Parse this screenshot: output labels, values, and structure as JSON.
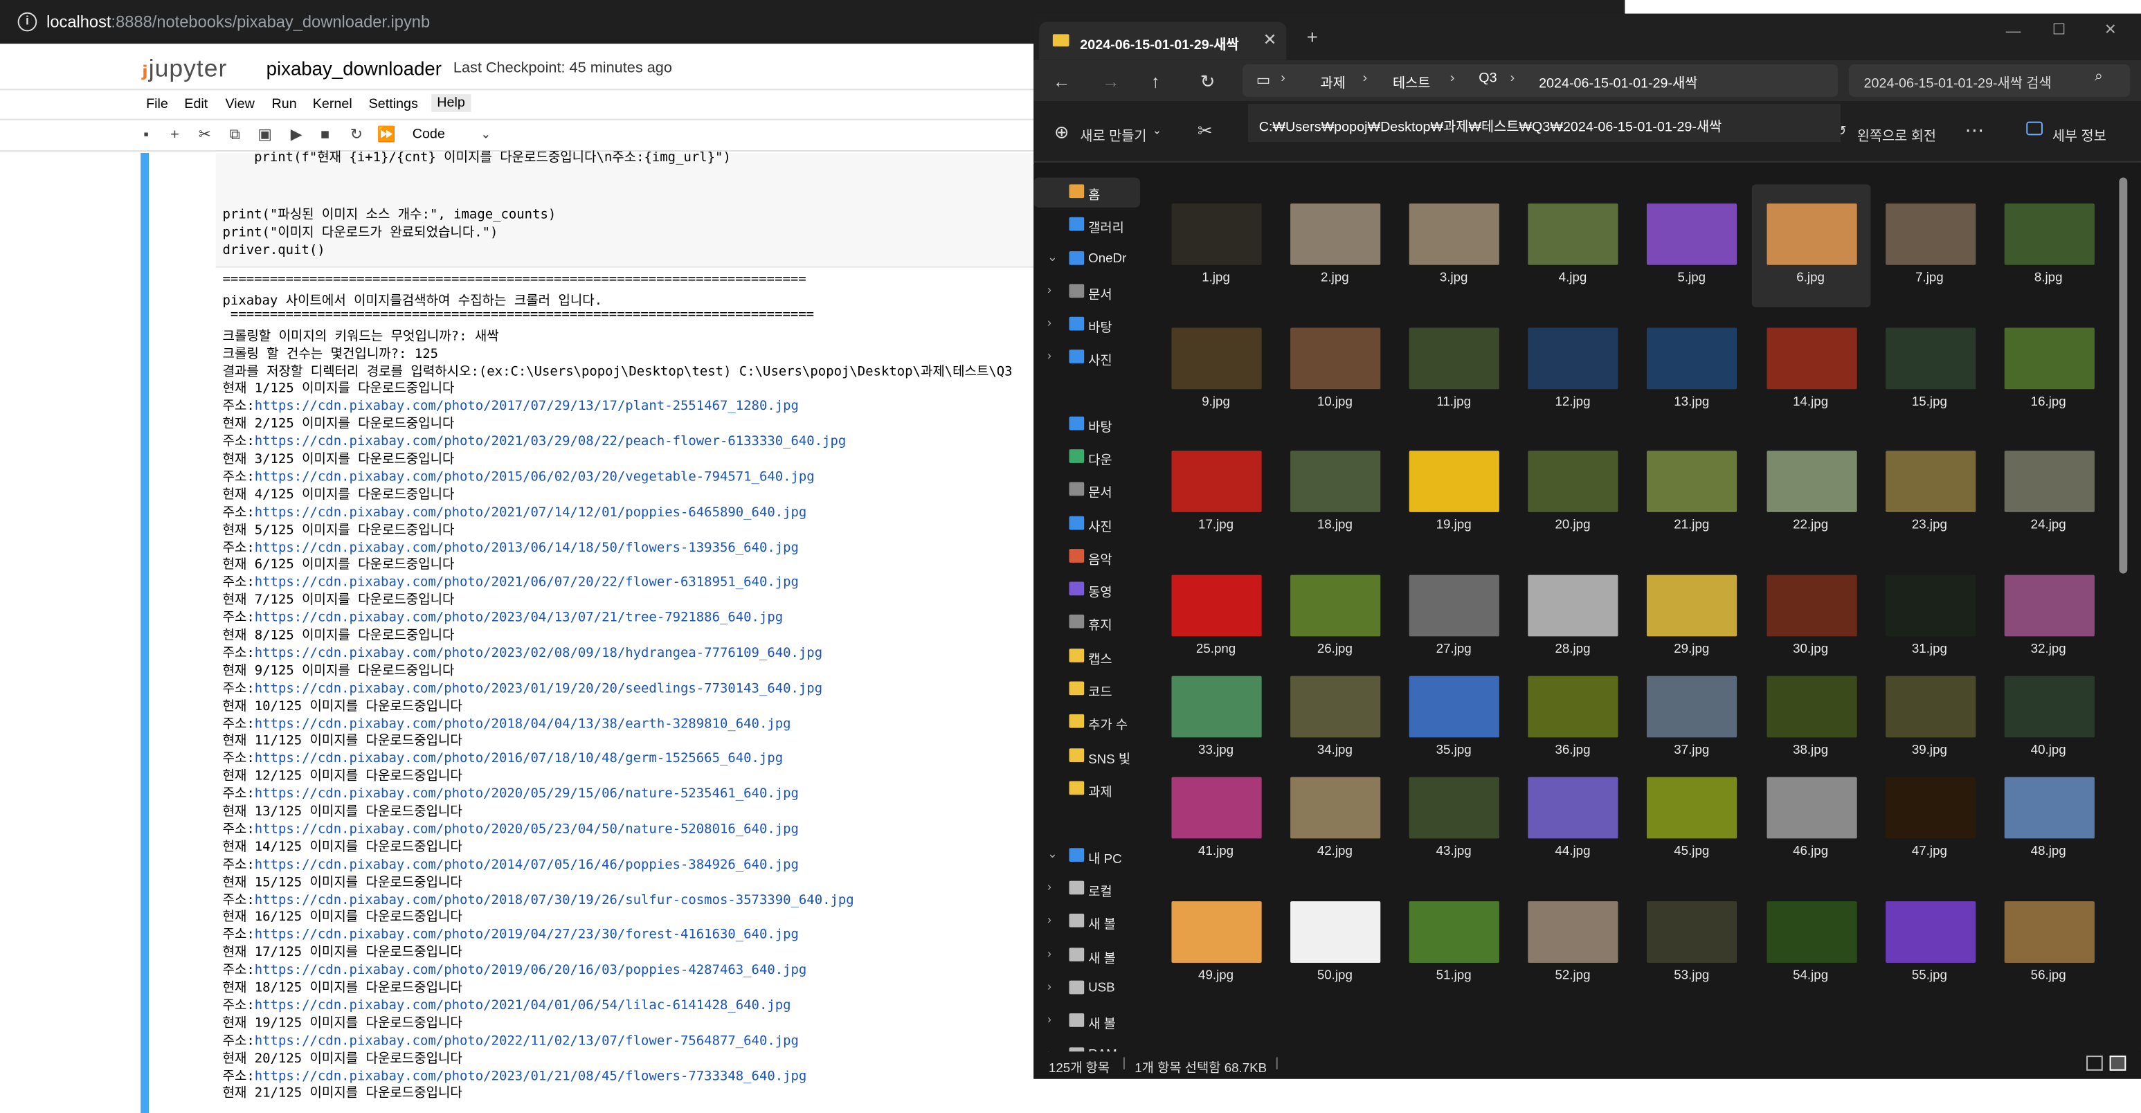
{
  "browser": {
    "host": "localhost",
    "url_path": ":8888/notebooks/pixabay_downloader.ipynb"
  },
  "notebook": {
    "logo": "jupyter",
    "name": "pixabay_downloader",
    "checkpoint": "Last Checkpoint: 45 minutes ago",
    "menu": [
      "File",
      "Edit",
      "View",
      "Run",
      "Kernel",
      "Settings",
      "Help"
    ],
    "celltype": "Code",
    "code_lines": [
      "    print(f\"현재 {i+1}/{cnt} 이미지를 다운로드중입니다\\n주소:{img_url}\")",
      "",
      "",
      "print(\"파싱된 이미지 소스 개수:\", image_counts)",
      "print(\"이미지 다운로드가 완료되었습니다.\")",
      "driver.quit()"
    ],
    "output_lines": [
      "==========================================================================",
      "pixabay 사이트에서 이미지를검색하여 수집하는 크롤러 입니다.",
      " ==========================================================================",
      "크롤링할 이미지의 키워드는 무엇입니까?: 새싹",
      "크롤링 할 건수는 몇건입니까?: 125",
      "결과를 저장할 디렉터리 경로를 입력하시오:(ex:C:\\Users\\popoj\\Desktop\\test) C:\\Users\\popoj\\Desktop\\과제\\테스트\\Q3",
      "현재 1/125 이미지를 다운로드중입니다",
      "주소:https://cdn.pixabay.com/photo/2017/07/29/13/17/plant-2551467_1280.jpg",
      "현재 2/125 이미지를 다운로드중입니다",
      "주소:https://cdn.pixabay.com/photo/2021/03/29/08/22/peach-flower-6133330_640.jpg",
      "현재 3/125 이미지를 다운로드중입니다",
      "주소:https://cdn.pixabay.com/photo/2015/06/02/03/20/vegetable-794571_640.jpg",
      "현재 4/125 이미지를 다운로드중입니다",
      "주소:https://cdn.pixabay.com/photo/2021/07/14/12/01/poppies-6465890_640.jpg",
      "현재 5/125 이미지를 다운로드중입니다",
      "주소:https://cdn.pixabay.com/photo/2013/06/14/18/50/flowers-139356_640.jpg",
      "현재 6/125 이미지를 다운로드중입니다",
      "주소:https://cdn.pixabay.com/photo/2021/06/07/20/22/flower-6318951_640.jpg",
      "현재 7/125 이미지를 다운로드중입니다",
      "주소:https://cdn.pixabay.com/photo/2023/04/13/07/21/tree-7921886_640.jpg",
      "현재 8/125 이미지를 다운로드중입니다",
      "주소:https://cdn.pixabay.com/photo/2023/02/08/09/18/hydrangea-7776109_640.jpg",
      "현재 9/125 이미지를 다운로드중입니다",
      "주소:https://cdn.pixabay.com/photo/2023/01/19/20/20/seedlings-7730143_640.jpg",
      "현재 10/125 이미지를 다운로드중입니다",
      "주소:https://cdn.pixabay.com/photo/2018/04/04/13/38/earth-3289810_640.jpg",
      "현재 11/125 이미지를 다운로드중입니다",
      "주소:https://cdn.pixabay.com/photo/2016/07/18/10/48/germ-1525665_640.jpg",
      "현재 12/125 이미지를 다운로드중입니다",
      "주소:https://cdn.pixabay.com/photo/2020/05/29/15/06/nature-5235461_640.jpg",
      "현재 13/125 이미지를 다운로드중입니다",
      "주소:https://cdn.pixabay.com/photo/2020/05/23/04/50/nature-5208016_640.jpg",
      "현재 14/125 이미지를 다운로드중입니다",
      "주소:https://cdn.pixabay.com/photo/2014/07/05/16/46/poppies-384926_640.jpg",
      "현재 15/125 이미지를 다운로드중입니다",
      "주소:https://cdn.pixabay.com/photo/2018/07/30/19/26/sulfur-cosmos-3573390_640.jpg",
      "현재 16/125 이미지를 다운로드중입니다",
      "주소:https://cdn.pixabay.com/photo/2019/04/27/23/30/forest-4161630_640.jpg",
      "현재 17/125 이미지를 다운로드중입니다",
      "주소:https://cdn.pixabay.com/photo/2019/06/20/16/03/poppies-4287463_640.jpg",
      "현재 18/125 이미지를 다운로드중입니다",
      "주소:https://cdn.pixabay.com/photo/2021/04/01/06/54/lilac-6141428_640.jpg",
      "현재 19/125 이미지를 다운로드중입니다",
      "주소:https://cdn.pixabay.com/photo/2022/11/02/13/07/flower-7564877_640.jpg",
      "현재 20/125 이미지를 다운로드중입니다",
      "주소:https://cdn.pixabay.com/photo/2023/01/21/08/45/flowers-7733348_640.jpg",
      "현재 21/125 이미지를 다운로드중입니다"
    ]
  },
  "explorer": {
    "tab_title": "2024-06-15-01-01-29-새싹",
    "breadcrumbs": [
      "과제",
      "테스트",
      "Q3",
      "2024-06-15-01-01-29-새싹"
    ],
    "search_placeholder": "2024-06-15-01-01-29-새싹 검색",
    "path_tooltip": "C:₩Users₩popoj₩Desktop₩과제₩테스트₩Q3₩2024-06-15-01-01-29-새싹",
    "new_label": "새로 만들기",
    "rotate_label": "왼쪽으로 회전",
    "details_label": "세부 정보",
    "sidebar": [
      "홈",
      "갤러리",
      "OneDr",
      "문서",
      "바탕",
      "사진",
      "바탕",
      "다운",
      "문서",
      "사진",
      "음악",
      "동영",
      "휴지",
      "캡스",
      "코드",
      "추가 수",
      "SNS 빛",
      "과제",
      "내 PC",
      "로컬",
      "새 볼",
      "새 볼",
      "USB",
      "새 볼",
      "RAM"
    ],
    "status_count": "125개 항목",
    "status_selection": "1개 항목 선택함 68.7KB",
    "files": [
      "1.jpg",
      "2.jpg",
      "3.jpg",
      "4.jpg",
      "5.jpg",
      "6.jpg",
      "7.jpg",
      "8.jpg",
      "9.jpg",
      "10.jpg",
      "11.jpg",
      "12.jpg",
      "13.jpg",
      "14.jpg",
      "15.jpg",
      "16.jpg",
      "17.jpg",
      "18.jpg",
      "19.jpg",
      "20.jpg",
      "21.jpg",
      "22.jpg",
      "23.jpg",
      "24.jpg",
      "25.png",
      "26.jpg",
      "27.jpg",
      "28.jpg",
      "29.jpg",
      "30.jpg",
      "31.jpg",
      "32.jpg",
      "33.jpg",
      "34.jpg",
      "35.jpg",
      "36.jpg",
      "37.jpg",
      "38.jpg",
      "39.jpg",
      "40.jpg",
      "41.jpg",
      "42.jpg",
      "43.jpg",
      "44.jpg",
      "45.jpg",
      "46.jpg",
      "47.jpg",
      "48.jpg",
      "49.jpg",
      "50.jpg",
      "51.jpg",
      "52.jpg",
      "53.jpg",
      "54.jpg",
      "55.jpg",
      "56.jpg"
    ],
    "thumb_colors": [
      "#2c2a22",
      "#8b7d6b",
      "#8a7c66",
      "#5b6e3b",
      "#7b4ab6",
      "#c98a4b",
      "#6a5a4a",
      "#3e5a2c",
      "#4a3b22",
      "#6b4a33",
      "#3a4a2a",
      "#1f3a5c",
      "#1f3e66",
      "#8a2a1a",
      "#2a3a2a",
      "#4a6a2a",
      "#b8201a",
      "#4a5a3a",
      "#e8b818",
      "#4a5a2a",
      "#6a7a3a",
      "#7a8a6a",
      "#7a6a3a",
      "#6a6a5a",
      "#c81818",
      "#5a7a2a",
      "#6a6a6a",
      "#aaaaaa",
      "#c8a838",
      "#6a2a1a",
      "#1a221a",
      "#8a4a7a",
      "#4a8a5a",
      "#5a5a3a",
      "#3a6ab8",
      "#5a6a1a",
      "#5a6a7a",
      "#3a4a1a",
      "#4a4a2a",
      "#2a3a2a",
      "#a83878",
      "#8a7a5a",
      "#3a4a2a",
      "#6a5ab8",
      "#7a8a1a",
      "#8a8a8a",
      "#2a1a0a",
      "#5a7aa8",
      "#e8a048",
      "#f0f0f0",
      "#4a7a2a",
      "#8a7a6a",
      "#3a3a2a",
      "#2a4a1a",
      "#6a3ab8",
      "#8a6a3a"
    ]
  }
}
